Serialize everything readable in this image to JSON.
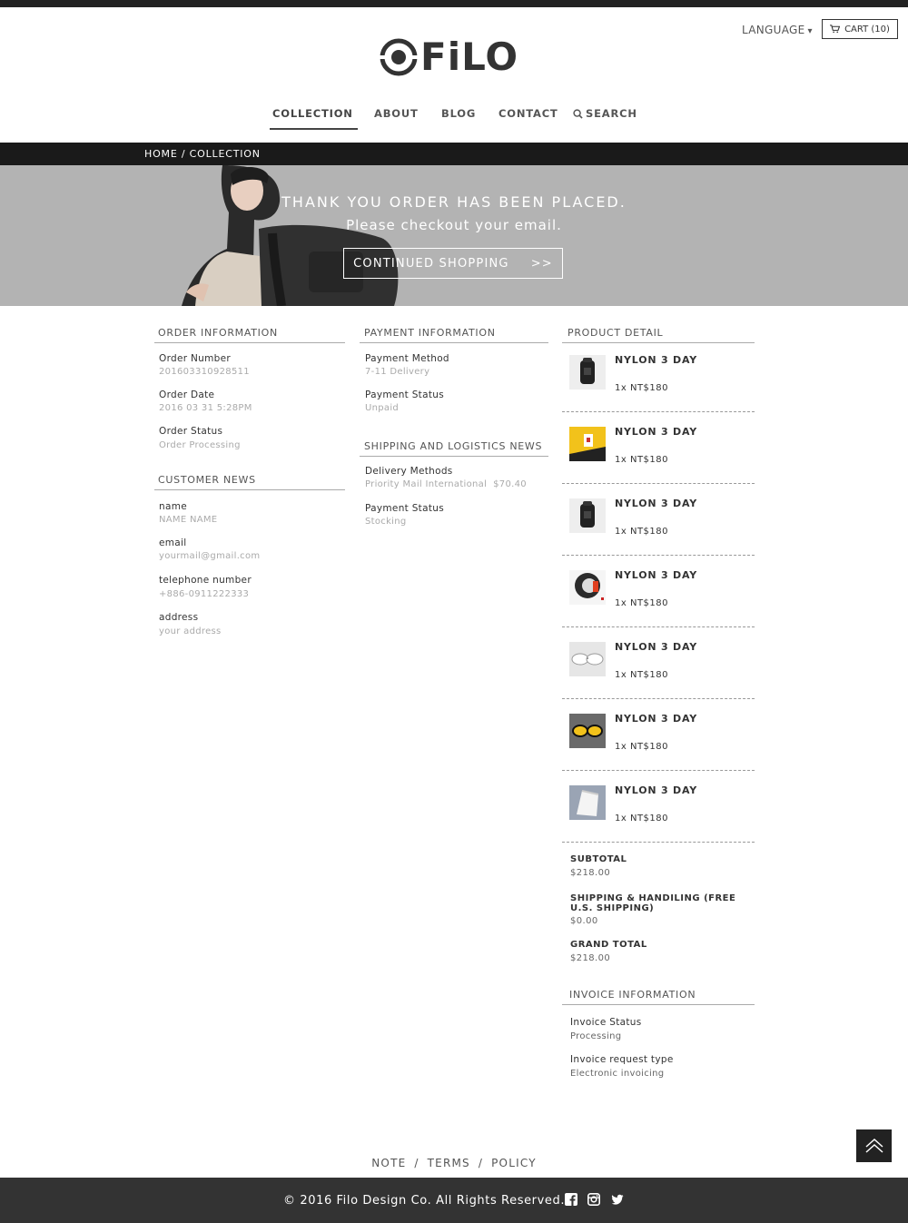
{
  "header": {
    "language_label": "LANGUAGE",
    "language_caret": "▾",
    "cart_label": "CART (10)",
    "logo_text": "FiLO"
  },
  "nav": {
    "items": [
      {
        "label": "COLLECTION",
        "active": true
      },
      {
        "label": "ABOUT"
      },
      {
        "label": "BLOG"
      },
      {
        "label": "CONTACT"
      },
      {
        "label": "SEARCH",
        "icon": "search-icon"
      }
    ]
  },
  "breadcrumb": "HOME / COLLECTION",
  "hero": {
    "title": "THANK YOU ORDER HAS BEEN PLACED.",
    "subtitle": "Please checkout your email.",
    "button_label": "CONTINUED SHOPPING",
    "button_arrow": ">>"
  },
  "order_info": {
    "title": "ORDER INFORMATION",
    "fields": [
      {
        "label": "Order Number",
        "value": "201603310928511"
      },
      {
        "label": "Order Date",
        "value": "2016 03 31 5:28PM"
      },
      {
        "label": "Order Status",
        "value": "Order Processing"
      }
    ]
  },
  "customer_news": {
    "title": "CUSTOMER NEWS",
    "fields": [
      {
        "label": "name",
        "value": "NAME NAME"
      },
      {
        "label": "email",
        "value": "yourmail@gmail.com"
      },
      {
        "label": "telephone number",
        "value": "+886-0911222333"
      },
      {
        "label": "address",
        "value": "your address"
      }
    ]
  },
  "payment_info": {
    "title": "PAYMENT INFORMATION",
    "fields": [
      {
        "label": "Payment Method",
        "value": "7-11 Delivery"
      },
      {
        "label": "Payment Status",
        "value": "Unpaid"
      }
    ]
  },
  "shipping_info": {
    "title": "SHIPPING AND LOGISTICS NEWS",
    "fields": [
      {
        "label": "Delivery Methods",
        "value": "Priority Mail International  $70.40"
      },
      {
        "label": "Payment Status",
        "value": "Stocking"
      }
    ]
  },
  "product_detail": {
    "title": "PRODUCT DETAIL",
    "items": [
      {
        "name": "NYLON 3 DAY",
        "price": "1x NT$180",
        "thumb": "black-backpack"
      },
      {
        "name": "NYLON 3 DAY",
        "price": "1x NT$180",
        "thumb": "yellow-bag"
      },
      {
        "name": "NYLON 3 DAY",
        "price": "1x NT$180",
        "thumb": "black-backpack"
      },
      {
        "name": "NYLON 3 DAY",
        "price": "1x NT$180",
        "thumb": "round-bag"
      },
      {
        "name": "NYLON 3 DAY",
        "price": "1x NT$180",
        "thumb": "white-sunglasses"
      },
      {
        "name": "NYLON 3 DAY",
        "price": "1x NT$180",
        "thumb": "yellow-sunglasses"
      },
      {
        "name": "NYLON 3 DAY",
        "price": "1x NT$180",
        "thumb": "white-pouch"
      }
    ]
  },
  "totals": {
    "subtotal_label": "SUBTOTAL",
    "subtotal_value": "$218.00",
    "shipping_label": "SHIPPING & HANDILING (FREE U.S. SHIPPING)",
    "shipping_value": "$0.00",
    "grand_label": "GRAND TOTAL",
    "grand_value": "$218.00"
  },
  "invoice_info": {
    "title": "INVOICE INFORMATION",
    "fields": [
      {
        "label": "Invoice Status",
        "value": "Processing"
      },
      {
        "label": "Invoice request type",
        "value": "Electronic invoicing"
      }
    ]
  },
  "footer": {
    "links": [
      "NOTE",
      "TERMS",
      "POLICY"
    ],
    "separator": "/",
    "copyright": "© 2016 Filo Design Co. All Rights Reserved.",
    "social_icons": [
      "facebook-icon",
      "instagram-icon",
      "twitter-icon"
    ]
  },
  "colors": {
    "dark_bar": "#1a1a1a",
    "hero_bg": "#b3b3b3",
    "footer_bg": "#333333",
    "accent_yellow": "#f2c21b"
  }
}
